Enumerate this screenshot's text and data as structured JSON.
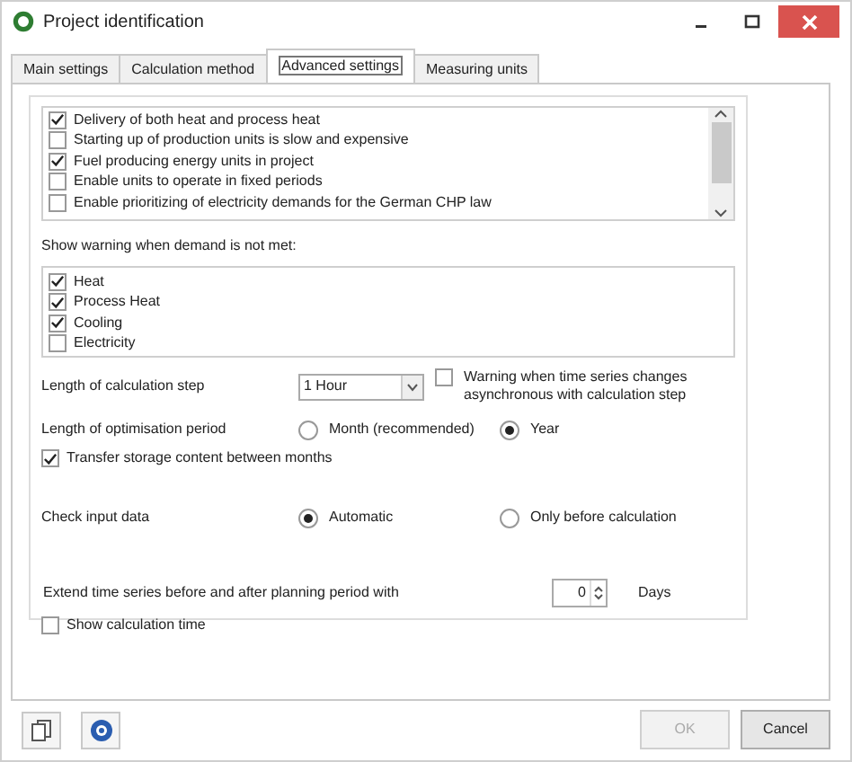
{
  "window": {
    "title": "Project identification"
  },
  "tabs": [
    {
      "label": "Main settings",
      "selected": false
    },
    {
      "label": "Calculation method",
      "selected": false
    },
    {
      "label": "Advanced settings",
      "selected": true
    },
    {
      "label": "Measuring units",
      "selected": false
    }
  ],
  "options_list": {
    "items": [
      {
        "label": "Delivery of both heat and process heat",
        "checked": true
      },
      {
        "label": "Starting up of production units is slow and expensive",
        "checked": false
      },
      {
        "label": "Fuel producing energy units in project",
        "checked": true
      },
      {
        "label": "Enable units to operate in fixed periods",
        "checked": false
      },
      {
        "label": "Enable prioritizing of electricity demands for the German CHP law",
        "checked": false
      }
    ]
  },
  "demand_warning": {
    "label": "Show warning when demand is not met:",
    "items": [
      {
        "label": "Heat",
        "checked": true
      },
      {
        "label": "Process Heat",
        "checked": true
      },
      {
        "label": "Cooling",
        "checked": true
      },
      {
        "label": "Electricity",
        "checked": false
      }
    ]
  },
  "calculation_step": {
    "label": "Length of calculation step",
    "value": "1 Hour",
    "warning": {
      "label": "Warning when time series changes asynchronous with calculation step",
      "checked": false
    }
  },
  "optimisation_period": {
    "label": "Length of optimisation period",
    "options": [
      {
        "label": "Month (recommended)",
        "selected": false
      },
      {
        "label": "Year",
        "selected": true
      }
    ]
  },
  "transfer_storage": {
    "label": "Transfer storage content between months",
    "checked": true
  },
  "check_input": {
    "label": "Check input data",
    "options": [
      {
        "label": "Automatic",
        "selected": true
      },
      {
        "label": "Only before calculation",
        "selected": false
      }
    ]
  },
  "extend_series": {
    "label": "Extend time series before and after planning period with",
    "value": "0",
    "unit": "Days"
  },
  "show_calc_time": {
    "label": "Show calculation time",
    "checked": false
  },
  "footer_buttons": [
    {
      "label": "OK",
      "disabled": true
    },
    {
      "label": "Cancel",
      "disabled": false
    }
  ]
}
